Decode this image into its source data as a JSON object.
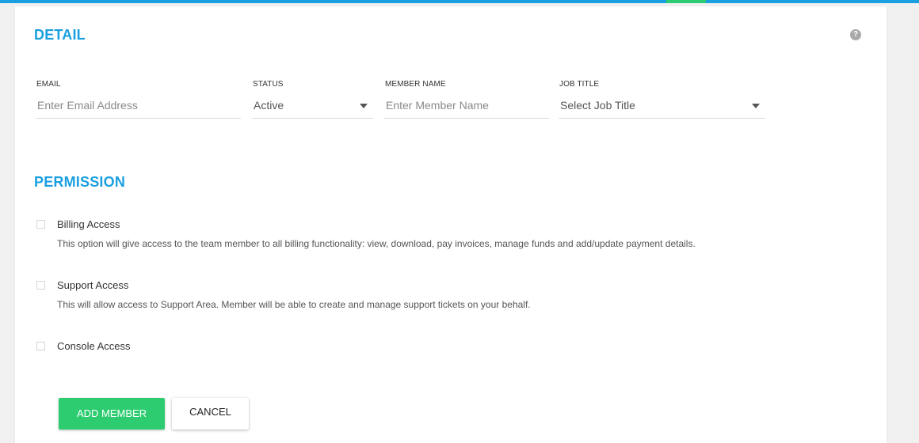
{
  "colors": {
    "accent_blue": "#1a9fe0",
    "accent_green": "#2ecc71",
    "section_title": "#1a9fe0"
  },
  "detail": {
    "title": "DETAIL",
    "help_icon": "?",
    "fields": {
      "email": {
        "label": "EMAIL",
        "placeholder": "Enter Email Address",
        "value": ""
      },
      "status": {
        "label": "STATUS",
        "value": "Active"
      },
      "member_name": {
        "label": "MEMBER NAME",
        "placeholder": "Enter Member Name",
        "value": ""
      },
      "job_title": {
        "label": "JOB TITLE",
        "value": "Select Job Title"
      }
    }
  },
  "permission": {
    "title": "PERMISSION",
    "items": [
      {
        "label": "Billing Access",
        "description": "This option will give access to the team member to all billing functionality: view, download, pay invoices, manage funds and add/update payment details.",
        "checked": false
      },
      {
        "label": "Support Access",
        "description": "This will allow access to Support Area. Member will be able to create and manage support tickets on your behalf.",
        "checked": false
      },
      {
        "label": "Console Access",
        "description": "",
        "checked": false
      }
    ]
  },
  "actions": {
    "add_label": "ADD MEMBER",
    "cancel_label": "CANCEL"
  }
}
